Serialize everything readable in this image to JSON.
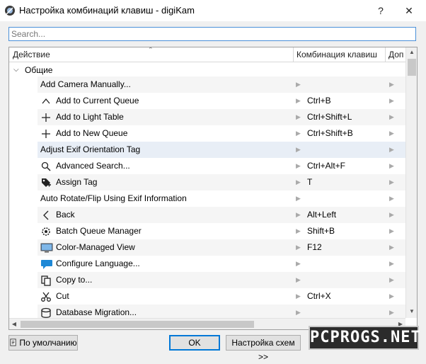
{
  "window": {
    "title": "Настройка комбинаций клавиш - digiKam",
    "help_label": "?",
    "close_label": "✕"
  },
  "search": {
    "placeholder": "Search..."
  },
  "columns": {
    "action": "Действие",
    "shortcut": "Комбинация клавиш",
    "alternate": "Доп"
  },
  "group": {
    "label": "Общие",
    "expanded": true
  },
  "rows": [
    {
      "name": "Add Camera Manually...",
      "icon": "",
      "shortcut": ""
    },
    {
      "name": "Add to Current Queue",
      "icon": "chevron-up-icon",
      "shortcut": "Ctrl+B"
    },
    {
      "name": "Add to Light Table",
      "icon": "plus-icon",
      "shortcut": "Ctrl+Shift+L"
    },
    {
      "name": "Add to New Queue",
      "icon": "plus-icon",
      "shortcut": "Ctrl+Shift+B"
    },
    {
      "name": "Adjust Exif Orientation Tag",
      "icon": "",
      "shortcut": ""
    },
    {
      "name": "Advanced Search...",
      "icon": "magnifier-icon",
      "shortcut": "Ctrl+Alt+F"
    },
    {
      "name": "Assign Tag",
      "icon": "tag-icon",
      "shortcut": "T"
    },
    {
      "name": "Auto Rotate/Flip Using Exif Information",
      "icon": "",
      "shortcut": ""
    },
    {
      "name": "Back",
      "icon": "back-chevron-icon",
      "shortcut": "Alt+Left"
    },
    {
      "name": "Batch Queue Manager",
      "icon": "gear-icon",
      "shortcut": "Shift+B"
    },
    {
      "name": "Color-Managed View",
      "icon": "monitor-icon",
      "shortcut": "F12"
    },
    {
      "name": "Configure Language...",
      "icon": "speech-bubble-icon",
      "shortcut": ""
    },
    {
      "name": "Copy to...",
      "icon": "copy-icon",
      "shortcut": ""
    },
    {
      "name": "Cut",
      "icon": "scissors-icon",
      "shortcut": "Ctrl+X"
    },
    {
      "name": "Database Migration...",
      "icon": "database-icon",
      "shortcut": ""
    }
  ],
  "buttons": {
    "defaults": "По умолчанию",
    "ok": "OK",
    "schemes": "Настройка схем >>"
  },
  "watermark": "PCPROGS.NET"
}
